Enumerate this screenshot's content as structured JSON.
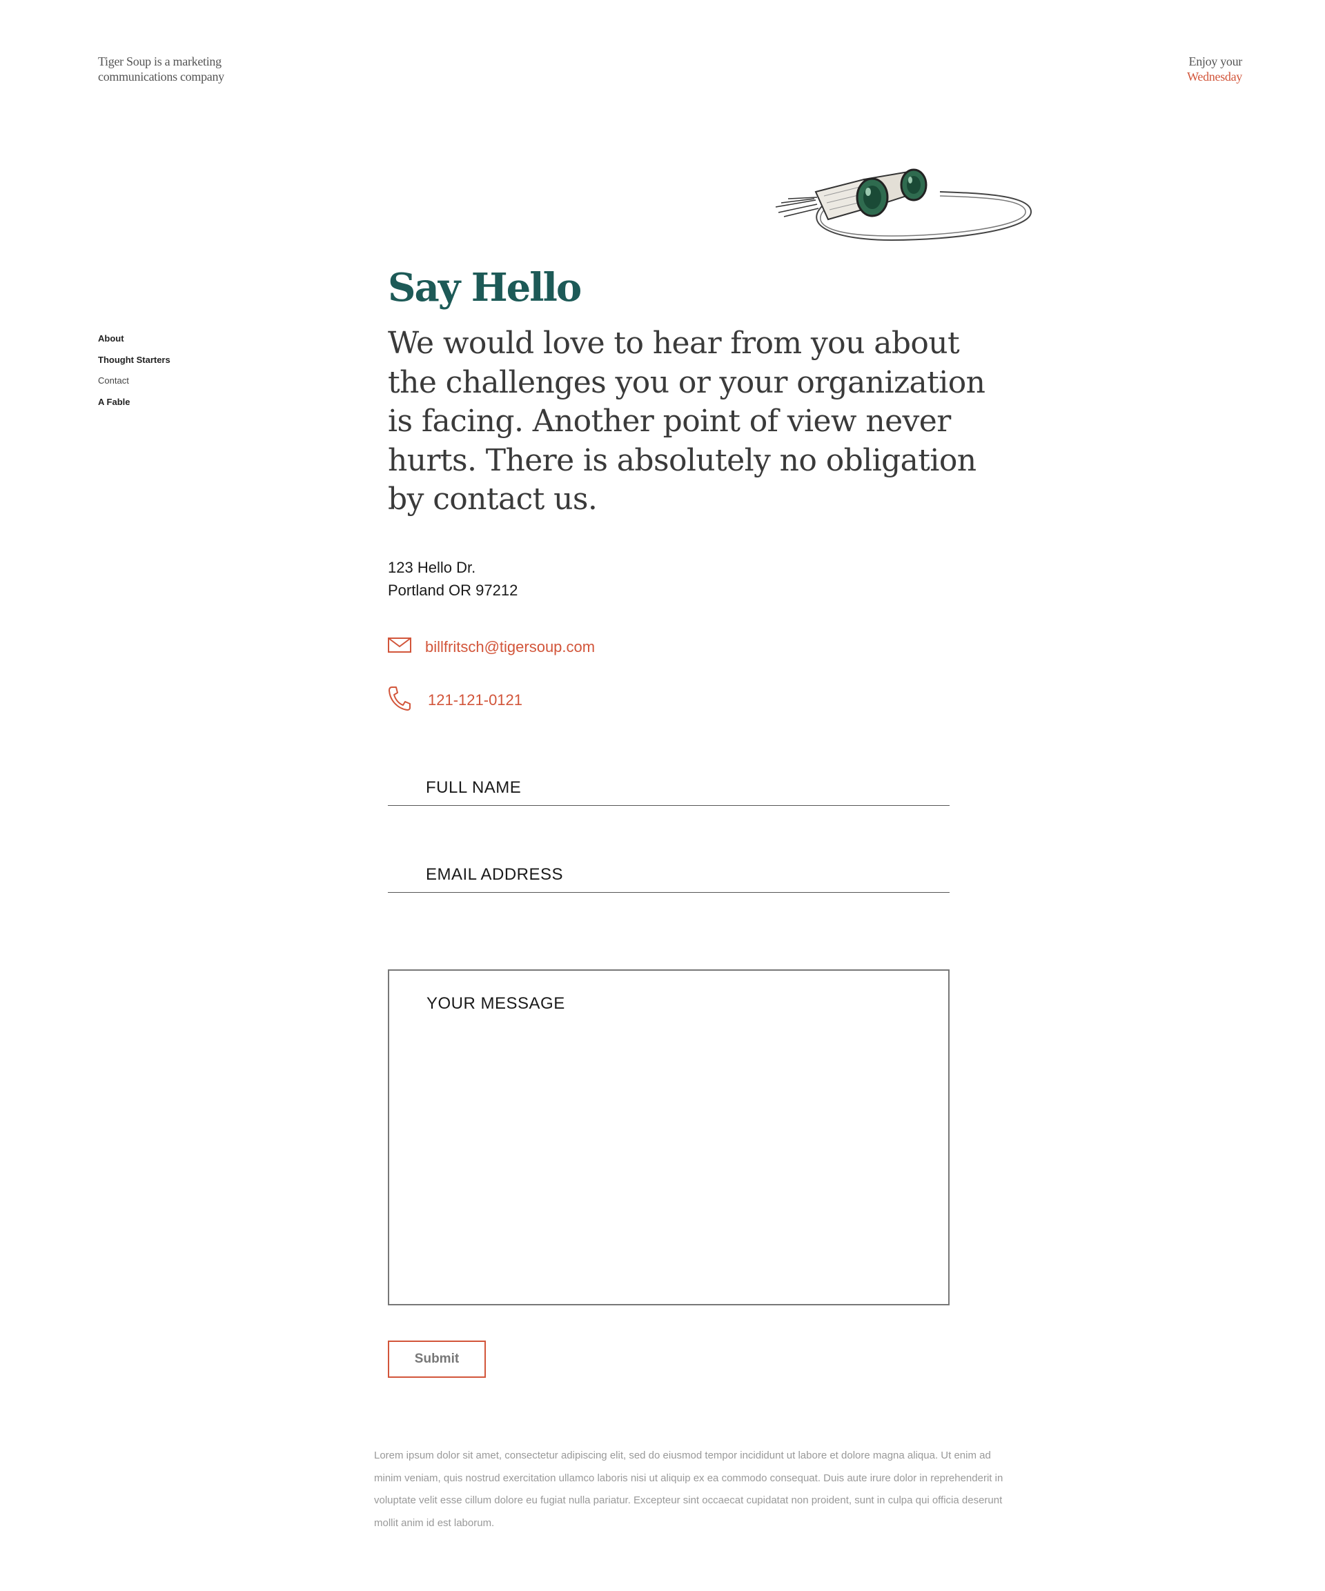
{
  "header": {
    "tagline_line1": "Tiger Soup is a marketing",
    "tagline_line2": "communications company",
    "greeting_prefix": "Enjoy your",
    "greeting_day": "Wednesday"
  },
  "nav": {
    "items": [
      {
        "label": "About"
      },
      {
        "label": "Thought Starters"
      },
      {
        "label": "Contact"
      },
      {
        "label": "A Fable"
      }
    ]
  },
  "main": {
    "title": "Say Hello",
    "intro": "We would love to hear from you about the challenges you or your organization is facing. Another point of view never hurts. There is absolutely no obligation by contact us.",
    "address_line1": "123 Hello Dr.",
    "address_line2": "Portland OR 97212",
    "email": "billfritsch@tigersoup.com",
    "phone": "121-121-0121"
  },
  "form": {
    "name_placeholder": "FULL NAME",
    "email_placeholder": "EMAIL ADDRESS",
    "message_placeholder": "YOUR MESSAGE",
    "submit_label": "Submit"
  },
  "footer": {
    "text": "Lorem ipsum dolor sit amet, consectetur adipiscing elit, sed do eiusmod tempor incididunt ut labore et dolore magna aliqua. Ut enim ad minim veniam, quis nostrud exercitation ullamco laboris nisi ut aliquip ex ea commodo consequat. Duis aute irure dolor in reprehenderit in voluptate velit esse cillum dolore eu fugiat nulla pariatur. Excepteur sint occaecat cupidatat non proident, sunt in culpa qui officia deserunt mollit anim id est laborum."
  },
  "colors": {
    "accent": "#d2553a",
    "heading": "#1d5a57",
    "body_text": "#3a3a3a",
    "muted": "#999999"
  },
  "icons": {
    "email": "envelope-icon",
    "phone": "phone-icon",
    "illustration": "binoculars-illustration"
  }
}
